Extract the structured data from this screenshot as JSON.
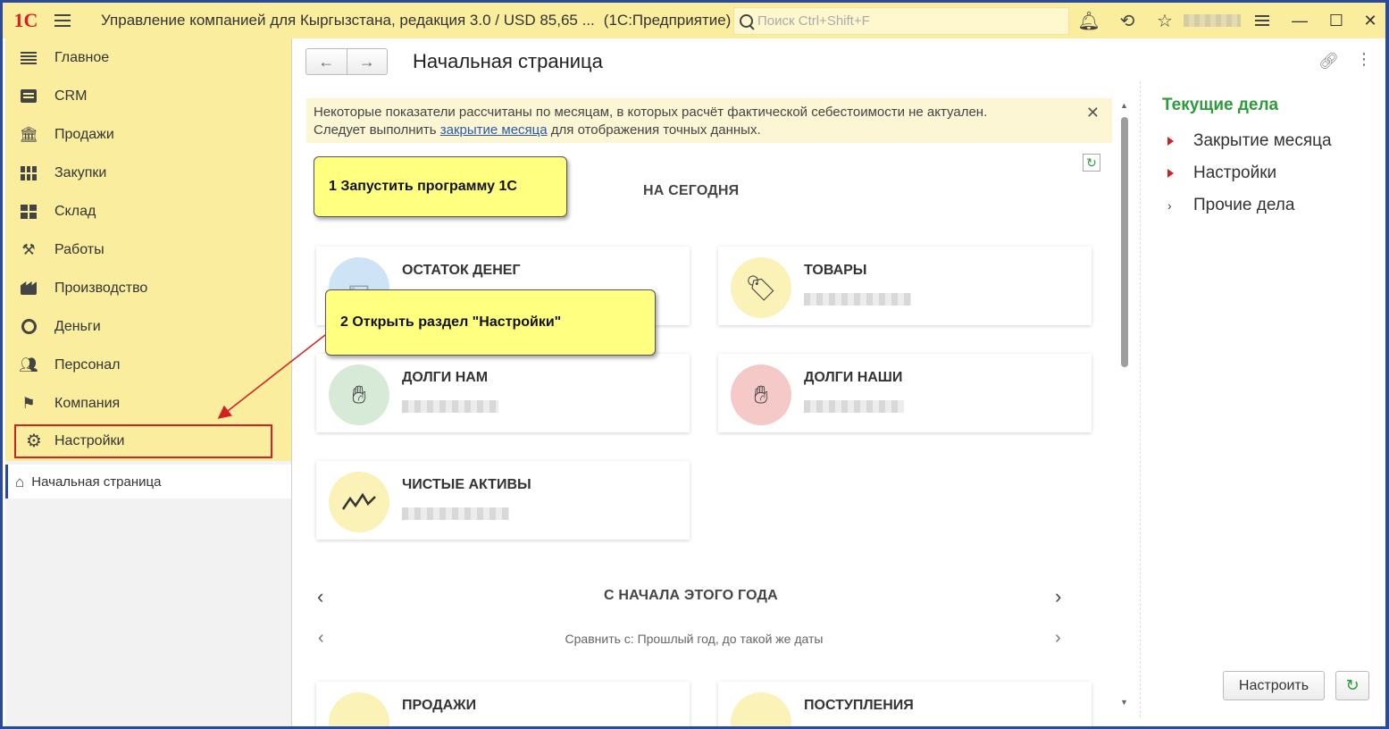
{
  "titlebar": {
    "logo": "1С",
    "title": "Управление компанией для Кыргызстана, редакция 3.0 / USD 85,65 ...",
    "suffix": "(1С:Предприятие)",
    "search_placeholder": "Поиск Ctrl+Shift+F"
  },
  "sidebar": {
    "items": [
      {
        "label": "Главное",
        "icon": "menu-lines-icon"
      },
      {
        "label": "CRM",
        "icon": "id-card-icon"
      },
      {
        "label": "Продажи",
        "icon": "basket-icon"
      },
      {
        "label": "Закупки",
        "icon": "cart-icon"
      },
      {
        "label": "Склад",
        "icon": "warehouse-icon"
      },
      {
        "label": "Работы",
        "icon": "tools-icon"
      },
      {
        "label": "Производство",
        "icon": "factory-icon"
      },
      {
        "label": "Деньги",
        "icon": "coin-icon"
      },
      {
        "label": "Персонал",
        "icon": "people-icon"
      },
      {
        "label": "Компания",
        "icon": "flag-icon"
      },
      {
        "label": "Настройки",
        "icon": "gear-icon"
      }
    ],
    "home_tab": "Начальная страница"
  },
  "main": {
    "page_title": "Начальная страница",
    "notice": {
      "text_before": "Некоторые показатели рассчитаны по месяцам, в которых расчёт фактической себестоимости не актуален.",
      "text_mid": "Следует выполнить ",
      "link": "закрытие месяца",
      "text_after": " для отображения точных данных."
    },
    "section_today": "НА СЕГОДНЯ",
    "tiles": [
      {
        "title": "ОСТАТОК ДЕНЕГ"
      },
      {
        "title": "ТОВАРЫ"
      },
      {
        "title": "ДОЛГИ НАМ"
      },
      {
        "title": "ДОЛГИ НАШИ"
      },
      {
        "title": "ЧИСТЫЕ АКТИВЫ"
      },
      {
        "title": "ПРОДАЖИ"
      },
      {
        "title": "ПОСТУПЛЕНИЯ"
      }
    ],
    "section_year": "С НАЧАЛА ЭТОГО ГОДА",
    "compare": "Сравнить с: Прошлый год, до такой же даты"
  },
  "callouts": {
    "step1": "1 Запустить программу 1С",
    "step2": "2 Открыть раздел \"Настройки\""
  },
  "right_pane": {
    "title": "Текущие дела",
    "items": [
      "Закрытие месяца",
      "Настройки",
      "Прочие дела"
    ],
    "configure_button": "Настроить"
  },
  "colors": {
    "sidebar_bg": "#fbed9e",
    "accent_green": "#2e9b3a",
    "highlight_red": "#d42020",
    "callout_yellow": "#ffff80"
  }
}
